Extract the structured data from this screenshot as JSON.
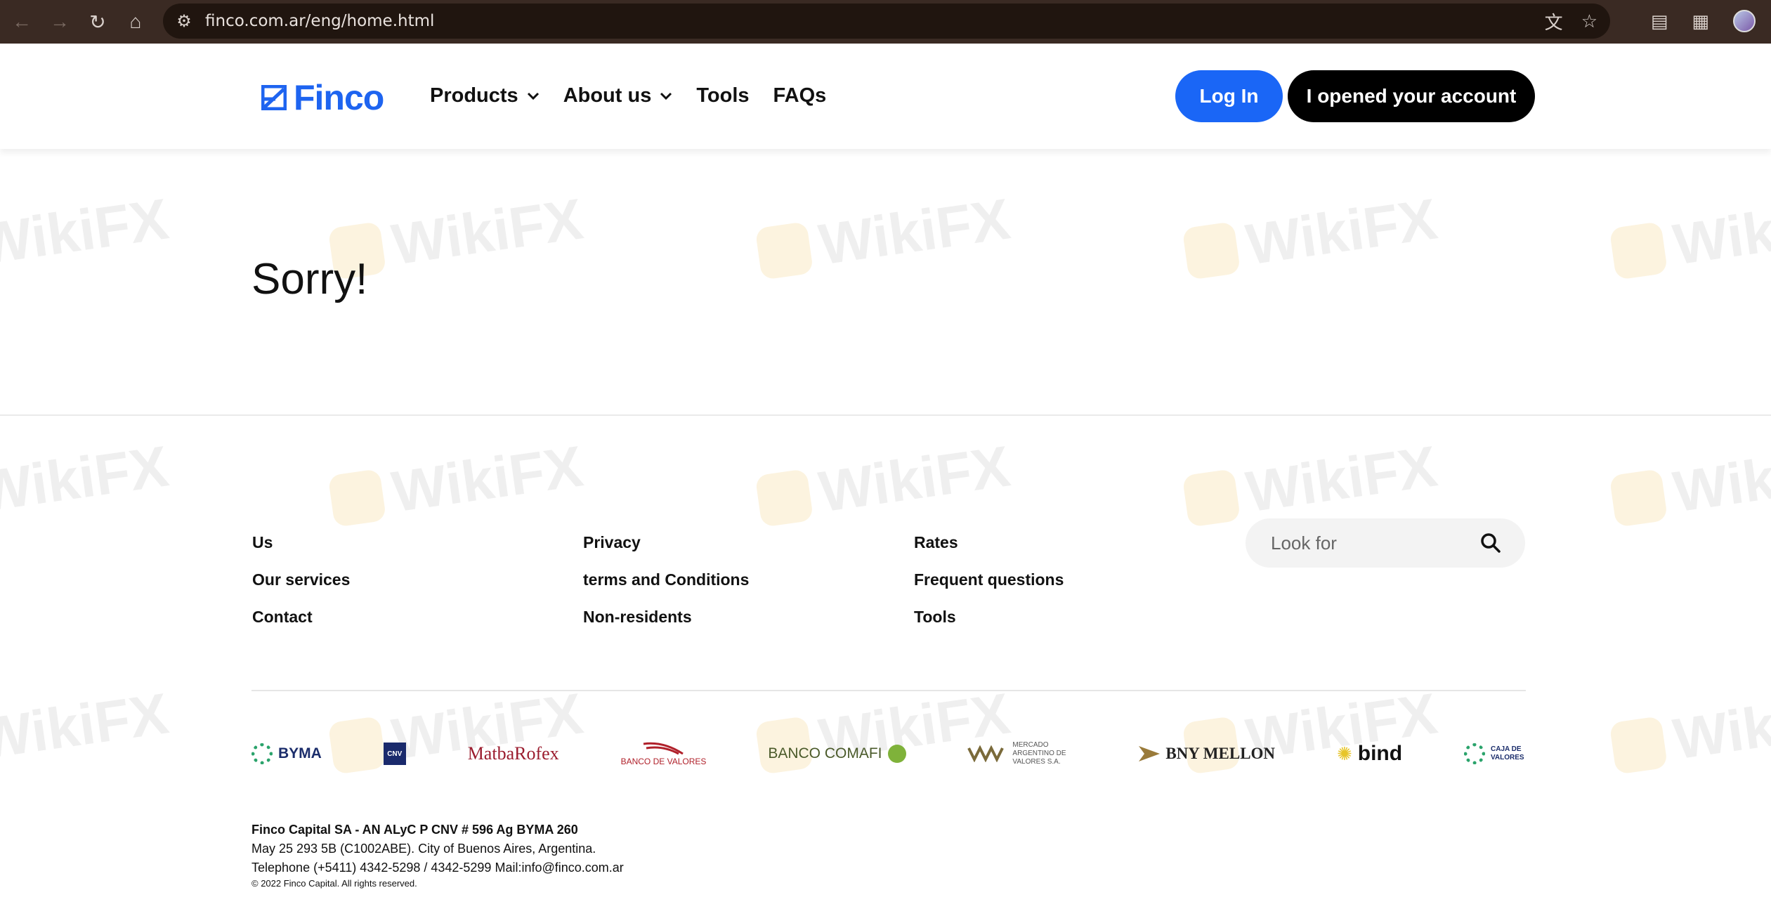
{
  "browser": {
    "url": "finco.com.ar/eng/home.html"
  },
  "header": {
    "logo_text": "Finco",
    "menu": [
      {
        "label": "Products",
        "dropdown": true
      },
      {
        "label": "About us",
        "dropdown": true
      },
      {
        "label": "Tools",
        "dropdown": false
      },
      {
        "label": "FAQs",
        "dropdown": false
      }
    ],
    "login_label": "Log In",
    "open_account_label": "I opened your account",
    "accent_color": "#1a66f6"
  },
  "main": {
    "heading": "Sorry!"
  },
  "footer": {
    "col1": [
      "Us",
      "Our services",
      "Contact"
    ],
    "col2": [
      "Privacy",
      "terms and Conditions",
      "Non-residents"
    ],
    "col3": [
      "Rates",
      "Frequent questions",
      "Tools"
    ],
    "search_placeholder": "Look for",
    "partners": [
      "BYMA",
      "CNV",
      "MatbaRofex",
      "BANCO DE VALORES",
      "BANCO COMAFI",
      "MERCADO ARGENTINO DE VALORES S.A.",
      "BNY MELLON",
      "bind",
      "CAJA DE VALORES"
    ],
    "address": {
      "company": "Finco Capital SA - AN ALyC P CNV # 596 Ag BYMA 260",
      "street": "May 25 293 5B (C1002ABE). City of Buenos Aires, Argentina.",
      "contact": "Telephone (+5411) 4342-5298 / 4342-5299 Mail:info@finco.com.ar",
      "copyright": "© 2022 Finco Capital. All rights reserved."
    }
  },
  "watermark_text": "WikiFX"
}
